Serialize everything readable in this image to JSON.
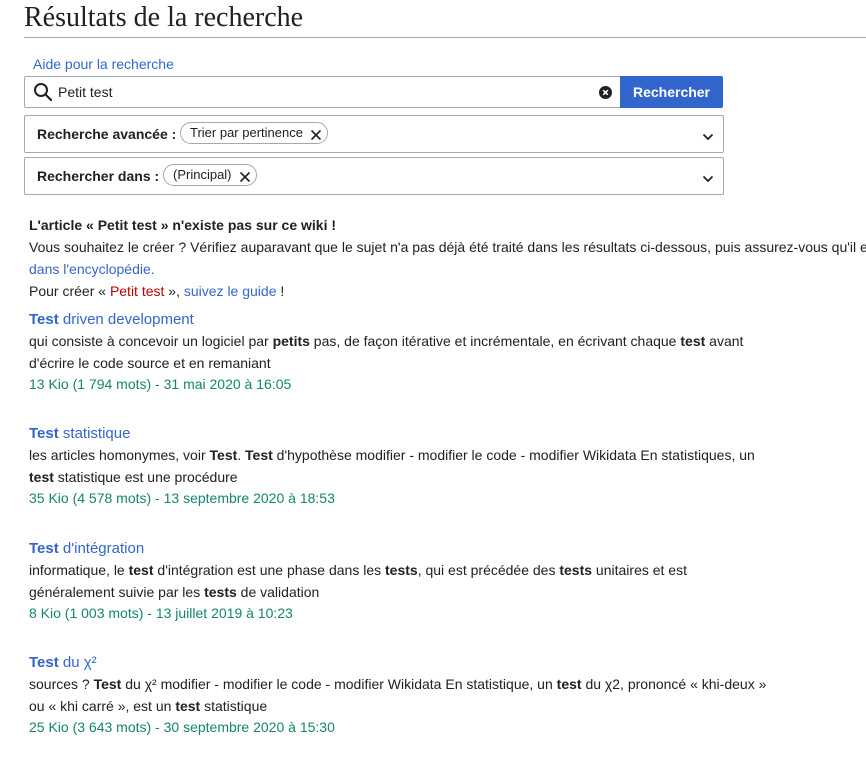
{
  "page": {
    "title": "Résultats de la recherche"
  },
  "search": {
    "help_link": "Aide pour la recherche",
    "query": "Petit test",
    "button_label": "Rechercher"
  },
  "advanced": {
    "label": "Recherche avancée :",
    "chip": "Trier par pertinence"
  },
  "namespaces": {
    "label": "Rechercher dans :",
    "chip": "(Principal)"
  },
  "notice": {
    "line1": "L'article « Petit test » n'existe pas sur ce wiki !",
    "line2": "Vous souhaitez le créer ? Vérifiez auparavant que le sujet n'a pas déjà été traité dans les résultats ci-dessous, puis assurez-vous qu'il e",
    "line3_link": "dans l'encyclopédie.",
    "line4_prefix": "Pour créer « ",
    "line4_red": "Petit test",
    "line4_mid": " », ",
    "line4_link": "suivez le guide",
    "line4_suffix": " !"
  },
  "results": [
    {
      "title_bold": "Test",
      "title_rest": " driven development",
      "snippet": [
        [
          "qui consiste à concevoir un logiciel par ",
          false
        ],
        [
          "petits",
          true
        ],
        [
          " pas, de façon itérative et incrémentale, en écrivant chaque ",
          false
        ],
        [
          "test",
          true
        ],
        [
          " avant",
          false
        ],
        [
          "\n",
          false
        ],
        [
          "d'écrire le code source et en remaniant",
          false
        ]
      ],
      "meta": "13 Kio (1 794 mots) - 31 mai 2020 à 16:05"
    },
    {
      "title_bold": "Test",
      "title_rest": " statistique",
      "snippet": [
        [
          "les articles homonymes, voir ",
          false
        ],
        [
          "Test",
          true
        ],
        [
          ". ",
          false
        ],
        [
          "Test",
          true
        ],
        [
          " d'hypothèse modifier - modifier le code - modifier Wikidata En statistiques, un",
          false
        ],
        [
          "\n",
          false
        ],
        [
          "test",
          true
        ],
        [
          " statistique est une procédure",
          false
        ]
      ],
      "meta": "35 Kio (4 578 mots) - 13 septembre 2020 à 18:53"
    },
    {
      "title_bold": "Test",
      "title_rest": " d'intégration",
      "snippet": [
        [
          "informatique, le ",
          false
        ],
        [
          "test",
          true
        ],
        [
          " d'intégration est une phase dans les ",
          false
        ],
        [
          "tests",
          true
        ],
        [
          ", qui est précédée des ",
          false
        ],
        [
          "tests",
          true
        ],
        [
          " unitaires et est",
          false
        ],
        [
          "\n",
          false
        ],
        [
          "généralement suivie par les ",
          false
        ],
        [
          "tests",
          true
        ],
        [
          " de validation",
          false
        ]
      ],
      "meta": "8 Kio (1 003 mots) - 13 juillet 2019 à 10:23"
    },
    {
      "title_bold": "Test",
      "title_rest": " du χ²",
      "snippet": [
        [
          "sources ? ",
          false
        ],
        [
          "Test",
          true
        ],
        [
          " du χ² modifier - modifier le code - modifier Wikidata En statistique, un ",
          false
        ],
        [
          "test",
          true
        ],
        [
          " du χ2, prononcé « khi-deux »",
          false
        ],
        [
          "\n",
          false
        ],
        [
          "ou « khi carré », est un ",
          false
        ],
        [
          "test",
          true
        ],
        [
          " statistique",
          false
        ]
      ],
      "meta": "25 Kio (3 643 mots) - 30 septembre 2020 à 15:30"
    }
  ]
}
